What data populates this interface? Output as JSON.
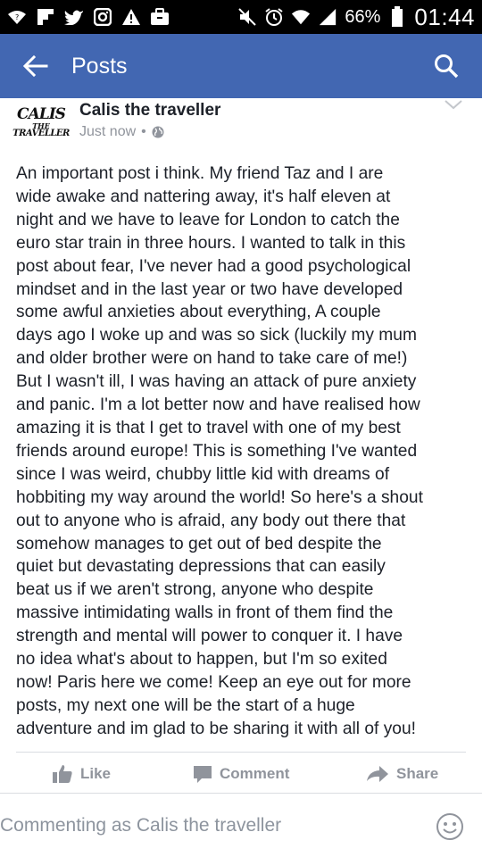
{
  "status_bar": {
    "battery": "66%",
    "time": "01:44"
  },
  "app_bar": {
    "title": "Posts"
  },
  "post": {
    "logo_lines": [
      "CALIS",
      "THE",
      "TRAVELLER"
    ],
    "author": "Calis the traveller",
    "timestamp": "Just now",
    "separator": "•",
    "body": "An important post i think. My friend Taz and I are\nwide awake and nattering away, it's half eleven at\nnight and we have to leave for London to catch the\neuro star train in three hours. I wanted to talk in this\npost about fear, I've never had a good psychological\nmindset and in the last year or two have developed\nsome awful anxieties about everything, A couple\ndays ago I woke up and was so sick (luckily my mum\nand older brother were on hand to take care of me!)\nBut I wasn't ill, I was having an attack of pure anxiety\nand panic. I'm a lot better now and have realised how\namazing it is that I get to travel with one of my best\nfriends around europe! This is something I've wanted\nsince I was weird, chubby little kid with dreams of\nhobbiting my way around the world! So here's a shout\nout to anyone who is afraid, any body out there that\nsomehow manages to get out of bed despite the\nquiet but devastating depressions that can easily\nbeat us if we aren't strong,  anyone who despite\nmassive intimidating walls in front of them find the\nstrength and mental will power to conquer it. I have\nno idea what's about to happen, but I'm so exited\nnow! Paris here we come! Keep an eye out for more\nposts, my next one will be the start of a huge\nadventure and im glad to be sharing it with all of you!",
    "actions": {
      "like": "Like",
      "comment": "Comment",
      "share": "Share"
    }
  },
  "comment_bar": {
    "placeholder": "Commenting as Calis the traveller"
  },
  "colors": {
    "brand_blue": "#4267b2",
    "muted_text": "#90949c",
    "body_text": "#1d2129"
  }
}
